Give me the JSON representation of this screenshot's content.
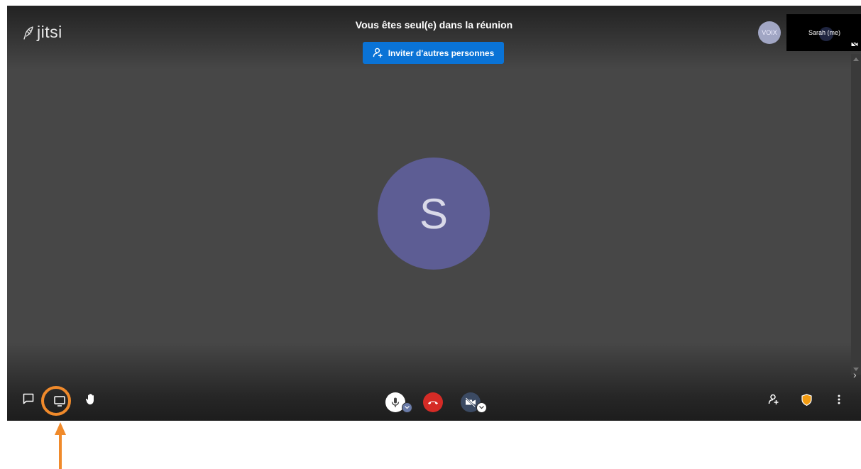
{
  "app": {
    "logo_text": "jitsi"
  },
  "header": {
    "title": "Vous êtes seul(e) dans la réunion",
    "invite_label": "Inviter d'autres personnes"
  },
  "participants": {
    "voice_avatar_text": "VOIX",
    "self_thumbnail_name": "Sarah (me)",
    "main_avatar_initial": "S"
  },
  "toolbar": {
    "left": [
      "chat-icon",
      "screen-share-icon",
      "raise-hand-icon"
    ],
    "center": [
      "microphone-icon",
      "hangup-icon",
      "camera-off-icon"
    ],
    "right": [
      "invite-participant-icon",
      "security-shield-icon",
      "more-options-icon"
    ]
  },
  "colors": {
    "accent_blue": "#0a73d6",
    "hangup_red": "#d52b26",
    "avatar_purple": "#5d5d94",
    "shield_orange": "#f39c12",
    "highlight_orange": "#f08a2b"
  }
}
